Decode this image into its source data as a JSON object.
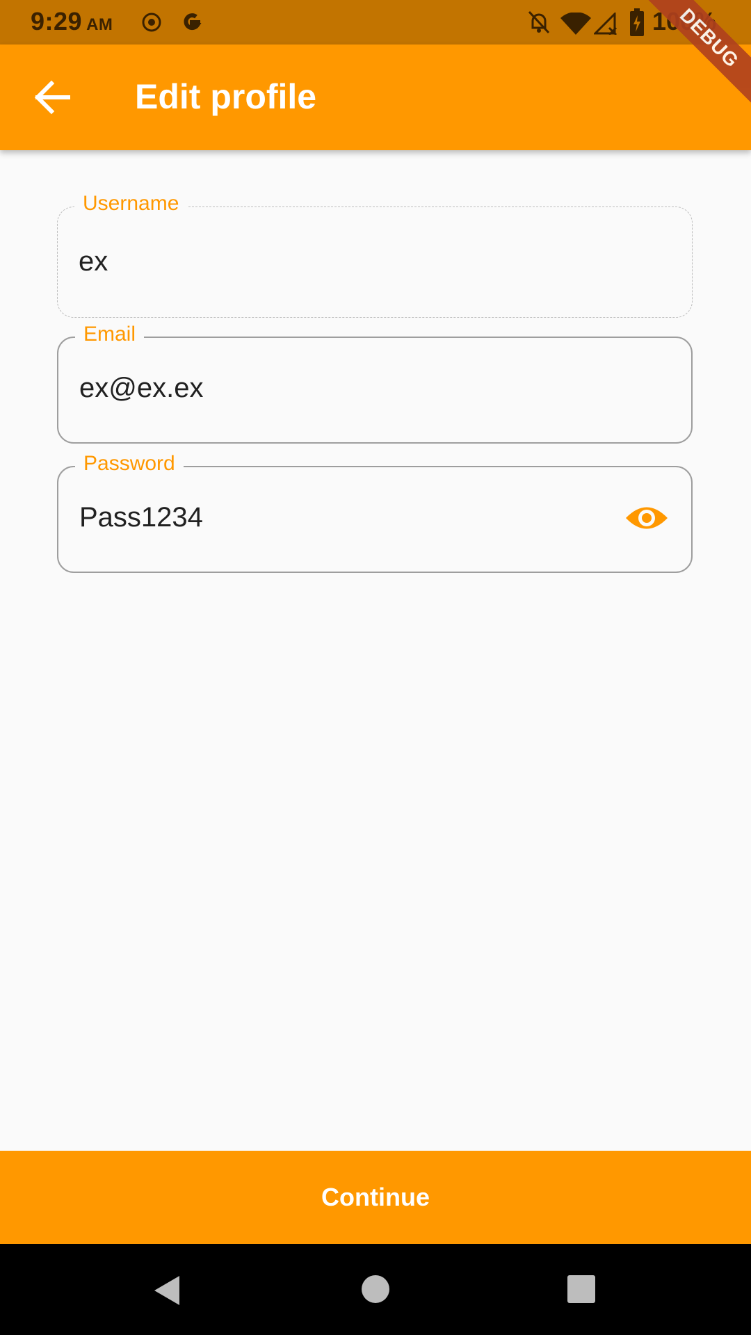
{
  "status_bar": {
    "time": "9:29",
    "ampm": "AM",
    "battery": "100%",
    "icons": [
      "location-icon",
      "google-icon",
      "notifications-off-icon",
      "wifi-icon",
      "signal-icon",
      "battery-charging-icon"
    ]
  },
  "app_bar": {
    "title": "Edit profile",
    "back_icon": "arrow-back-icon",
    "background": "#ff9800"
  },
  "debug_banner": "DEBUG",
  "form": {
    "username": {
      "label": "Username",
      "value": "ex"
    },
    "email": {
      "label": "Email",
      "value": "ex@ex.ex"
    },
    "password": {
      "label": "Password",
      "value": "Pass1234",
      "toggle_icon": "visibility-icon"
    }
  },
  "continue_button": {
    "label": "Continue"
  },
  "nav_bar": {
    "buttons": [
      "back-triangle-icon",
      "home-circle-icon",
      "recents-square-icon"
    ]
  },
  "colors": {
    "accent": "#ff9800",
    "status_bar": "#c27400",
    "label": "#ff9800"
  }
}
